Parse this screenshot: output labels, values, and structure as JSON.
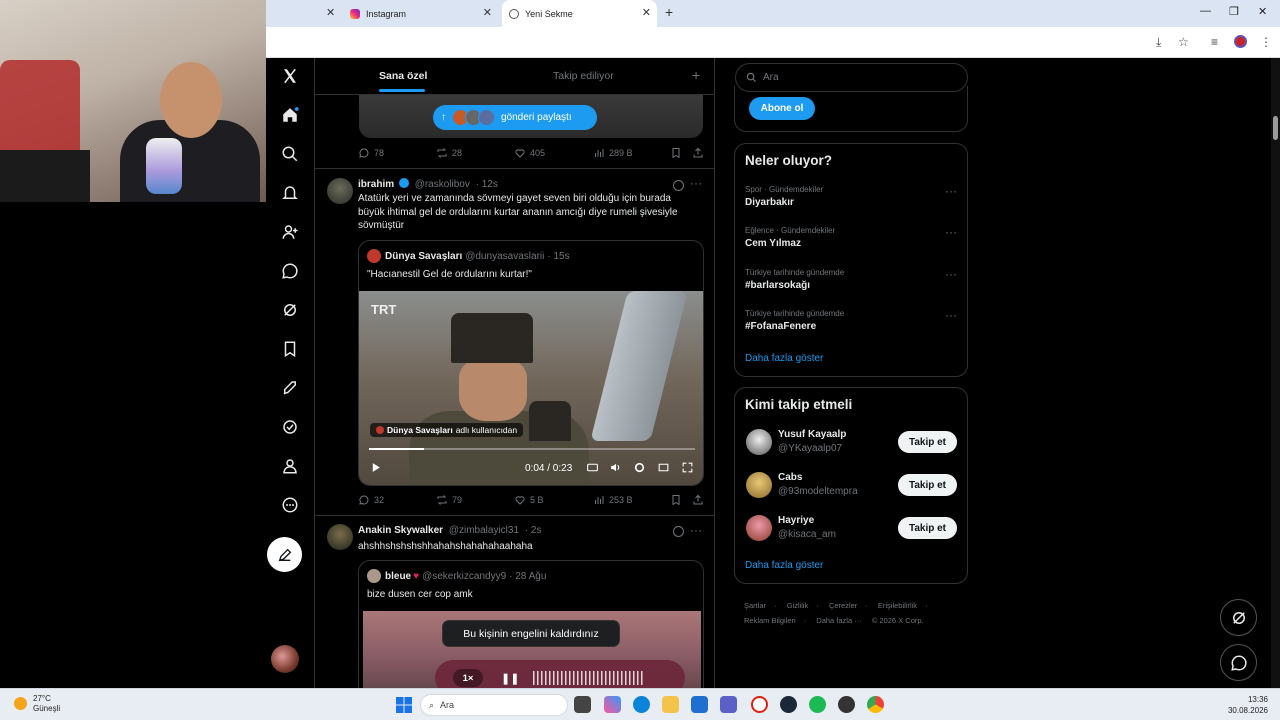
{
  "browser": {
    "tabs": [
      {
        "label": "Instagram"
      },
      {
        "label": "Yeni Sekme"
      }
    ]
  },
  "nav": {
    "items": [
      "x-logo-icon",
      "home-icon",
      "search-icon",
      "bell-icon",
      "add-user-icon",
      "message-icon",
      "grok-icon",
      "bookmark-icon",
      "rocket-icon",
      "verified-icon",
      "profile-icon",
      "more-icon"
    ]
  },
  "timeline": {
    "tabs": {
      "for_you": "Sana özel",
      "following": "Takip ediliyor"
    },
    "share_pill": "gönderi paylaştı",
    "posts": [
      {
        "stats": {
          "replies": "78",
          "reposts": "28",
          "likes": "405",
          "views": "289 B"
        }
      },
      {
        "name": "ibrahim",
        "handle": "@raskolibov",
        "time": "· 12s",
        "text": "Atatürk yeri ve zamanında sövmeyi gayet seven biri olduğu için burada büyük ihtimal gel de ordularını kurtar ananın amcığı diye rumeli şivesiyle sövmüştür",
        "quote": {
          "name": "Dünya Savaşları",
          "handle": "@dunyasavaslarii",
          "time": "· 15s",
          "text": "\"Hacıanestil Gel de ordularını kurtar!\"",
          "video": {
            "watermark": "TRT",
            "byline_name": "Dünya Savaşları",
            "byline_suffix": "adlı kullanıcıdan",
            "time": "0:04 / 0:23",
            "progress": 0.17
          }
        },
        "stats": {
          "replies": "32",
          "reposts": "79",
          "likes": "5 B",
          "views": "253 B"
        }
      },
      {
        "name": "Anakin Skywalker",
        "handle": "@zimbalayicl31",
        "time": "· 2s",
        "text": "ahshhshshshshhahahshahahahaahaha",
        "quote": {
          "name": "bleue",
          "handle": "@sekerkizcandyy9",
          "time": "· 28 Ağu",
          "text": "bize dusen cer cop amk"
        }
      }
    ],
    "toast": "Bu kişinin engelini kaldırdınız",
    "voice_speed": "1×"
  },
  "right": {
    "search_placeholder": "Ara",
    "subscribe": "Abone ol",
    "trends_title": "Neler oluyor?",
    "trends": [
      {
        "category": "Spor · Gündemdekiler",
        "name": "Diyarbakır"
      },
      {
        "category": "Eğlence · Gündemdekiler",
        "name": "Cem Yılmaz"
      },
      {
        "category": "Türkiye tarihinde gündemde",
        "name": "#barlarsokağı"
      },
      {
        "category": "Türkiye tarihinde gündemde",
        "name": "#FofanaFenere"
      }
    ],
    "show_more": "Daha fazla göster",
    "wtf_title": "Kimi takip etmeli",
    "wtf": [
      {
        "name": "Yusuf Kayaalp",
        "handle": "@YKayaalp07",
        "button": "Takip et"
      },
      {
        "name": "Cabs",
        "handle": "@93modeltempra",
        "button": "Takip et"
      },
      {
        "name": "Hayriye",
        "handle": "@kisaca_am",
        "button": "Takip et"
      }
    ],
    "footer": [
      "Şartlar",
      "Gizlilik",
      "Çerezler",
      "Erişilebilirlik",
      "Reklam Bilgileri",
      "Daha fazla ···",
      "© 2026 X Corp."
    ]
  },
  "taskbar": {
    "temp": "27°C",
    "weather": "Güneşli",
    "search": "Ara",
    "time": "13:36",
    "date": "30.08.2026"
  },
  "colors": {
    "accent": "#1d9bf0",
    "bg": "#000000",
    "border": "#2f3336",
    "muted": "#71767b"
  }
}
